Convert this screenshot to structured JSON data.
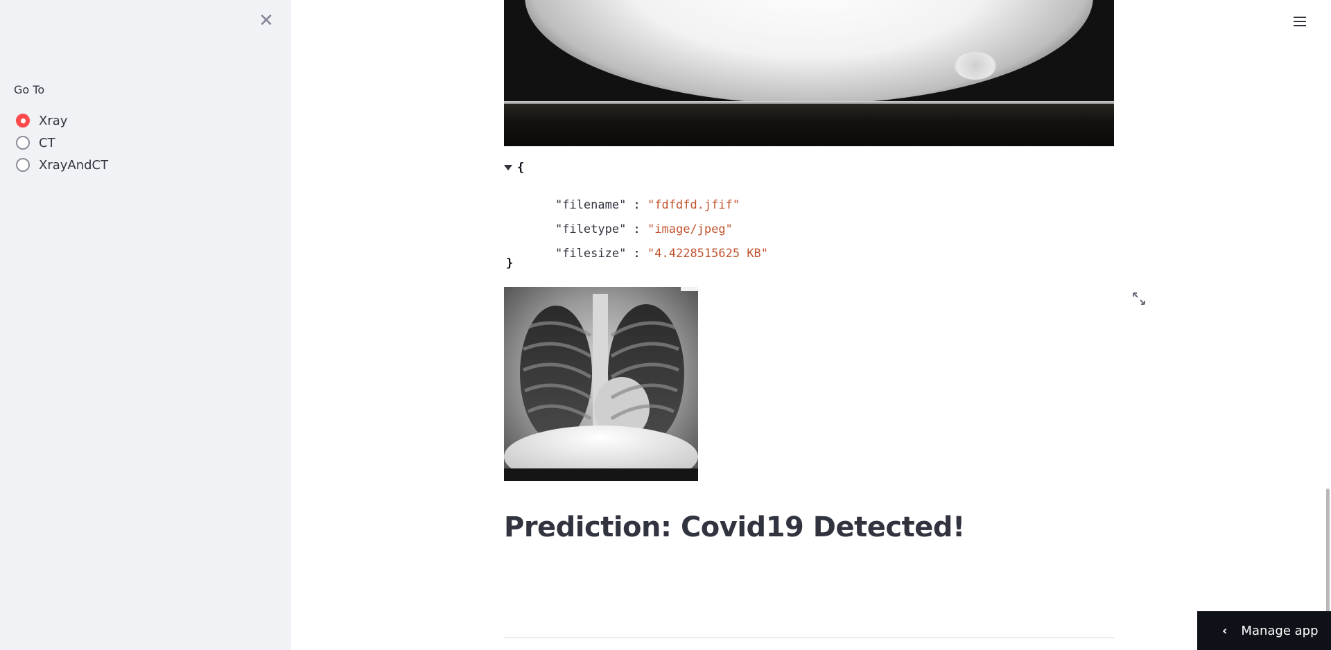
{
  "sidebar": {
    "close_glyph": "✕",
    "goto_label": "Go To",
    "options": [
      {
        "label": "Xray",
        "selected": true
      },
      {
        "label": "CT",
        "selected": false
      },
      {
        "label": "XrayAndCT",
        "selected": false
      }
    ]
  },
  "file_info": {
    "brace_open": "{",
    "brace_close": "}",
    "rows": [
      {
        "key": "\"filename\"",
        "value": "\"fdfdfd.jfif\""
      },
      {
        "key": "\"filetype\"",
        "value": "\"image/jpeg\""
      },
      {
        "key": "\"filesize\"",
        "value": "\"4.4228515625 KB\""
      }
    ]
  },
  "prediction": {
    "text": "Prediction: Covid19 Detected!"
  },
  "manage_app": {
    "chevron": "‹",
    "label": "Manage app"
  },
  "icons": {
    "close": "close-icon",
    "menu": "hamburger-menu-icon",
    "expand": "expand-icon",
    "chevron": "chevron-left-icon"
  },
  "colors": {
    "accent": "#ff4b4b",
    "sidebar_bg": "#f0f2f6",
    "json_string": "#c0532d",
    "manage_bg": "#0e1117"
  }
}
